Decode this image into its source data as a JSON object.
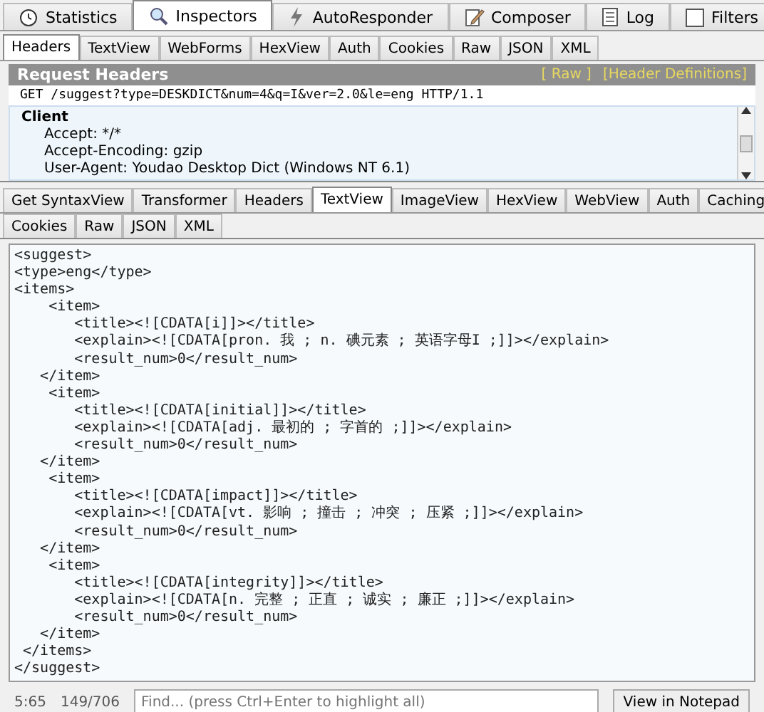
{
  "top_tabs": [
    {
      "label": "Statistics",
      "selected": false
    },
    {
      "label": "Inspectors",
      "selected": true
    },
    {
      "label": "AutoResponder",
      "selected": false
    },
    {
      "label": "Composer",
      "selected": false
    },
    {
      "label": "Log",
      "selected": false
    },
    {
      "label": "Filters",
      "selected": false
    }
  ],
  "request_tabs": [
    {
      "label": "Headers",
      "selected": true
    },
    {
      "label": "TextView",
      "selected": false
    },
    {
      "label": "WebForms",
      "selected": false
    },
    {
      "label": "HexView",
      "selected": false
    },
    {
      "label": "Auth",
      "selected": false
    },
    {
      "label": "Cookies",
      "selected": false
    },
    {
      "label": "Raw",
      "selected": false
    },
    {
      "label": "JSON",
      "selected": false
    },
    {
      "label": "XML",
      "selected": false
    }
  ],
  "request_headers": {
    "title": "Request Headers",
    "links": [
      "[ Raw ]",
      "[Header Definitions]"
    ],
    "request_line": "GET /suggest?type=DESKDICT&num=4&q=I&ver=2.0&le=eng HTTP/1.1",
    "group": "Client",
    "headers": [
      "Accept: */*",
      "Accept-Encoding: gzip",
      "User-Agent: Youdao Desktop Dict (Windows NT 6.1)"
    ]
  },
  "response_tabs": [
    [
      {
        "label": "Get SyntaxView",
        "selected": false
      },
      {
        "label": "Transformer",
        "selected": false
      },
      {
        "label": "Headers",
        "selected": false
      },
      {
        "label": "TextView",
        "selected": true
      },
      {
        "label": "ImageView",
        "selected": false
      },
      {
        "label": "HexView",
        "selected": false
      },
      {
        "label": "WebView",
        "selected": false
      },
      {
        "label": "Auth",
        "selected": false
      },
      {
        "label": "Caching",
        "selected": false
      }
    ],
    [
      {
        "label": "Cookies",
        "selected": false
      },
      {
        "label": "Raw",
        "selected": false
      },
      {
        "label": "JSON",
        "selected": false
      },
      {
        "label": "XML",
        "selected": false
      }
    ]
  ],
  "text_lines": [
    "<suggest>",
    "<type>eng</type>",
    "<items>",
    "    <item>",
    "       <title><![CDATA[i]]></title>",
    "       <explain><![CDATA[pron. 我 ; n. 碘元素 ; 英语字母I ;]]></explain>",
    "       <result_num>0</result_num>",
    "   </item>",
    "    <item>",
    "       <title><![CDATA[initial]]></title>",
    "       <explain><![CDATA[adj. 最初的 ; 字首的 ;]]></explain>",
    "       <result_num>0</result_num>",
    "   </item>",
    "    <item>",
    "       <title><![CDATA[impact]]></title>",
    "       <explain><![CDATA[vt. 影响 ; 撞击 ; 冲突 ; 压紧 ;]]></explain>",
    "       <result_num>0</result_num>",
    "   </item>",
    "    <item>",
    "       <title><![CDATA[integrity]]></title>",
    "       <explain><![CDATA[n. 完整 ; 正直 ; 诚实 ; 廉正 ;]]></explain>",
    "       <result_num>0</result_num>",
    "   </item>",
    " </items>",
    "</suggest>"
  ],
  "status_bar": {
    "position": "5:65",
    "selection": "149/706",
    "find": {
      "placeholder": "Find... (press Ctrl+Enter to highlight all)"
    },
    "button": "View in Notepad"
  }
}
